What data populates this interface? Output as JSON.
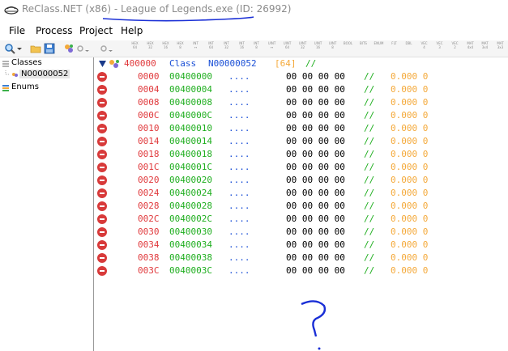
{
  "window": {
    "title_app": "ReClass.NET (x86)",
    "title_sep": " - ",
    "title_process": "League of Legends.exe (ID: 26992)"
  },
  "menu": [
    "File",
    "Process",
    "Project",
    "Help"
  ],
  "toolbar": {
    "type_buttons": [
      [
        "HEX",
        "64"
      ],
      [
        "HEX",
        "32"
      ],
      [
        "HEX",
        "16"
      ],
      [
        "HEX",
        "8"
      ],
      [
        "INT",
        "↔"
      ],
      [
        "INT",
        "64"
      ],
      [
        "INT",
        "32"
      ],
      [
        "INT",
        "16"
      ],
      [
        "INT",
        "8"
      ],
      [
        "UINT",
        "↔"
      ],
      [
        "UINT",
        "64"
      ],
      [
        "UINT",
        "32"
      ],
      [
        "UINT",
        "16"
      ],
      [
        "UINT",
        "8"
      ],
      [
        "BOOL",
        ""
      ],
      [
        "BITS",
        ""
      ],
      [
        "ENUM",
        ""
      ],
      [
        "FLT",
        ""
      ],
      [
        "DBL",
        ""
      ],
      [
        "VEC",
        "4"
      ],
      [
        "VEC",
        "3"
      ],
      [
        "VEC",
        "2"
      ],
      [
        "MAT",
        "4x4"
      ],
      [
        "MAT",
        "3x4"
      ],
      [
        "MAT",
        "3x3"
      ]
    ]
  },
  "tree": {
    "classes_label": "Classes",
    "class_item": "N00000052",
    "enums_label": "Enums"
  },
  "header": {
    "address": "400000",
    "keyword": "Class",
    "name": "N00000052",
    "size": "[64]",
    "comment": "//"
  },
  "rows": [
    {
      "offset": "0000",
      "address": "00400000",
      "dots": "....",
      "bytes": "00 00 00 00",
      "comment": "//",
      "value": "0.000 0"
    },
    {
      "offset": "0004",
      "address": "00400004",
      "dots": "....",
      "bytes": "00 00 00 00",
      "comment": "//",
      "value": "0.000 0"
    },
    {
      "offset": "0008",
      "address": "00400008",
      "dots": "....",
      "bytes": "00 00 00 00",
      "comment": "//",
      "value": "0.000 0"
    },
    {
      "offset": "000C",
      "address": "0040000C",
      "dots": "....",
      "bytes": "00 00 00 00",
      "comment": "//",
      "value": "0.000 0"
    },
    {
      "offset": "0010",
      "address": "00400010",
      "dots": "....",
      "bytes": "00 00 00 00",
      "comment": "//",
      "value": "0.000 0"
    },
    {
      "offset": "0014",
      "address": "00400014",
      "dots": "....",
      "bytes": "00 00 00 00",
      "comment": "//",
      "value": "0.000 0"
    },
    {
      "offset": "0018",
      "address": "00400018",
      "dots": "....",
      "bytes": "00 00 00 00",
      "comment": "//",
      "value": "0.000 0"
    },
    {
      "offset": "001C",
      "address": "0040001C",
      "dots": "....",
      "bytes": "00 00 00 00",
      "comment": "//",
      "value": "0.000 0"
    },
    {
      "offset": "0020",
      "address": "00400020",
      "dots": "....",
      "bytes": "00 00 00 00",
      "comment": "//",
      "value": "0.000 0"
    },
    {
      "offset": "0024",
      "address": "00400024",
      "dots": "....",
      "bytes": "00 00 00 00",
      "comment": "//",
      "value": "0.000 0"
    },
    {
      "offset": "0028",
      "address": "00400028",
      "dots": "....",
      "bytes": "00 00 00 00",
      "comment": "//",
      "value": "0.000 0"
    },
    {
      "offset": "002C",
      "address": "0040002C",
      "dots": "....",
      "bytes": "00 00 00 00",
      "comment": "//",
      "value": "0.000 0"
    },
    {
      "offset": "0030",
      "address": "00400030",
      "dots": "....",
      "bytes": "00 00 00 00",
      "comment": "//",
      "value": "0.000 0"
    },
    {
      "offset": "0034",
      "address": "00400034",
      "dots": "....",
      "bytes": "00 00 00 00",
      "comment": "//",
      "value": "0.000 0"
    },
    {
      "offset": "0038",
      "address": "00400038",
      "dots": "....",
      "bytes": "00 00 00 00",
      "comment": "//",
      "value": "0.000 0"
    },
    {
      "offset": "003C",
      "address": "0040003C",
      "dots": "....",
      "bytes": "00 00 00 00",
      "comment": "//",
      "value": "0.000 0"
    }
  ]
}
